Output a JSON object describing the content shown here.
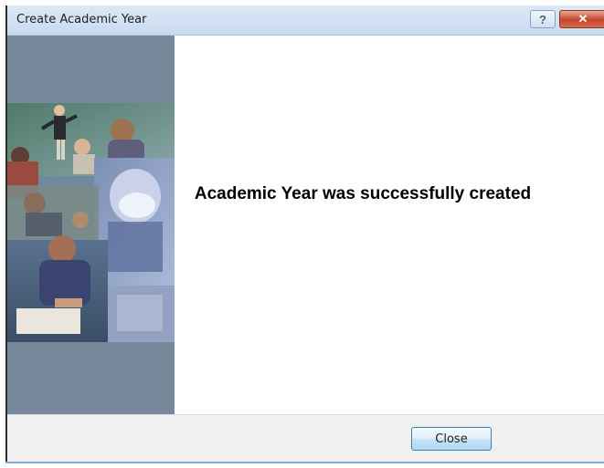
{
  "window": {
    "title": "Create Academic Year",
    "help_label": "?",
    "close_label": "✕"
  },
  "message": {
    "text": "Academic Year was successfully created"
  },
  "footer": {
    "close_label": "Close"
  },
  "colors": {
    "side_panel": "#76889a",
    "button_border": "#3c7fb1",
    "close_red": "#c6452b"
  },
  "icons": {
    "help": "help-icon",
    "close": "close-icon"
  }
}
